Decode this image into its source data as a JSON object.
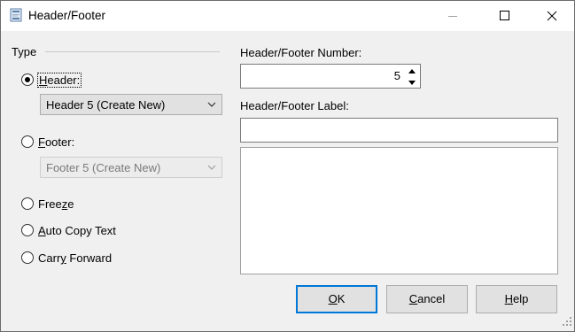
{
  "window": {
    "title": "Header/Footer"
  },
  "type_group": {
    "legend": "Type",
    "header_radio": {
      "pre": "",
      "accel": "H",
      "post": "eader:",
      "checked": true
    },
    "header_select": {
      "value": "Header 5 (Create New)"
    },
    "footer_radio": {
      "pre": "",
      "accel": "F",
      "post": "ooter:",
      "checked": false
    },
    "footer_select": {
      "value": "Footer 5 (Create New)",
      "disabled": true
    },
    "freeze_radio": {
      "pre": "Free",
      "accel": "z",
      "post": "e",
      "checked": false
    },
    "auto_copy_radio": {
      "pre": "",
      "accel": "A",
      "post": "uto Copy Text",
      "checked": false
    },
    "carry_forward_radio": {
      "pre": "Carr",
      "accel": "y",
      "post": " Forward",
      "checked": false
    }
  },
  "number": {
    "label": "Header/Footer Number:",
    "value": "5"
  },
  "label_field": {
    "label": "Header/Footer Label:",
    "value": ""
  },
  "notes": {
    "value": ""
  },
  "buttons": {
    "ok": {
      "pre": "",
      "accel": "O",
      "post": "K"
    },
    "cancel": {
      "pre": "",
      "accel": "C",
      "post": "ancel"
    },
    "help": {
      "pre": "",
      "accel": "H",
      "post": "elp"
    }
  },
  "colors": {
    "accent": "#0078d7",
    "dialog_bg": "#f0f0f0"
  },
  "icons": [
    "app-icon",
    "minimize-icon",
    "maximize-icon",
    "close-icon",
    "chevron-down-icon",
    "spin-up-icon",
    "spin-down-icon",
    "resize-grip-icon"
  ]
}
